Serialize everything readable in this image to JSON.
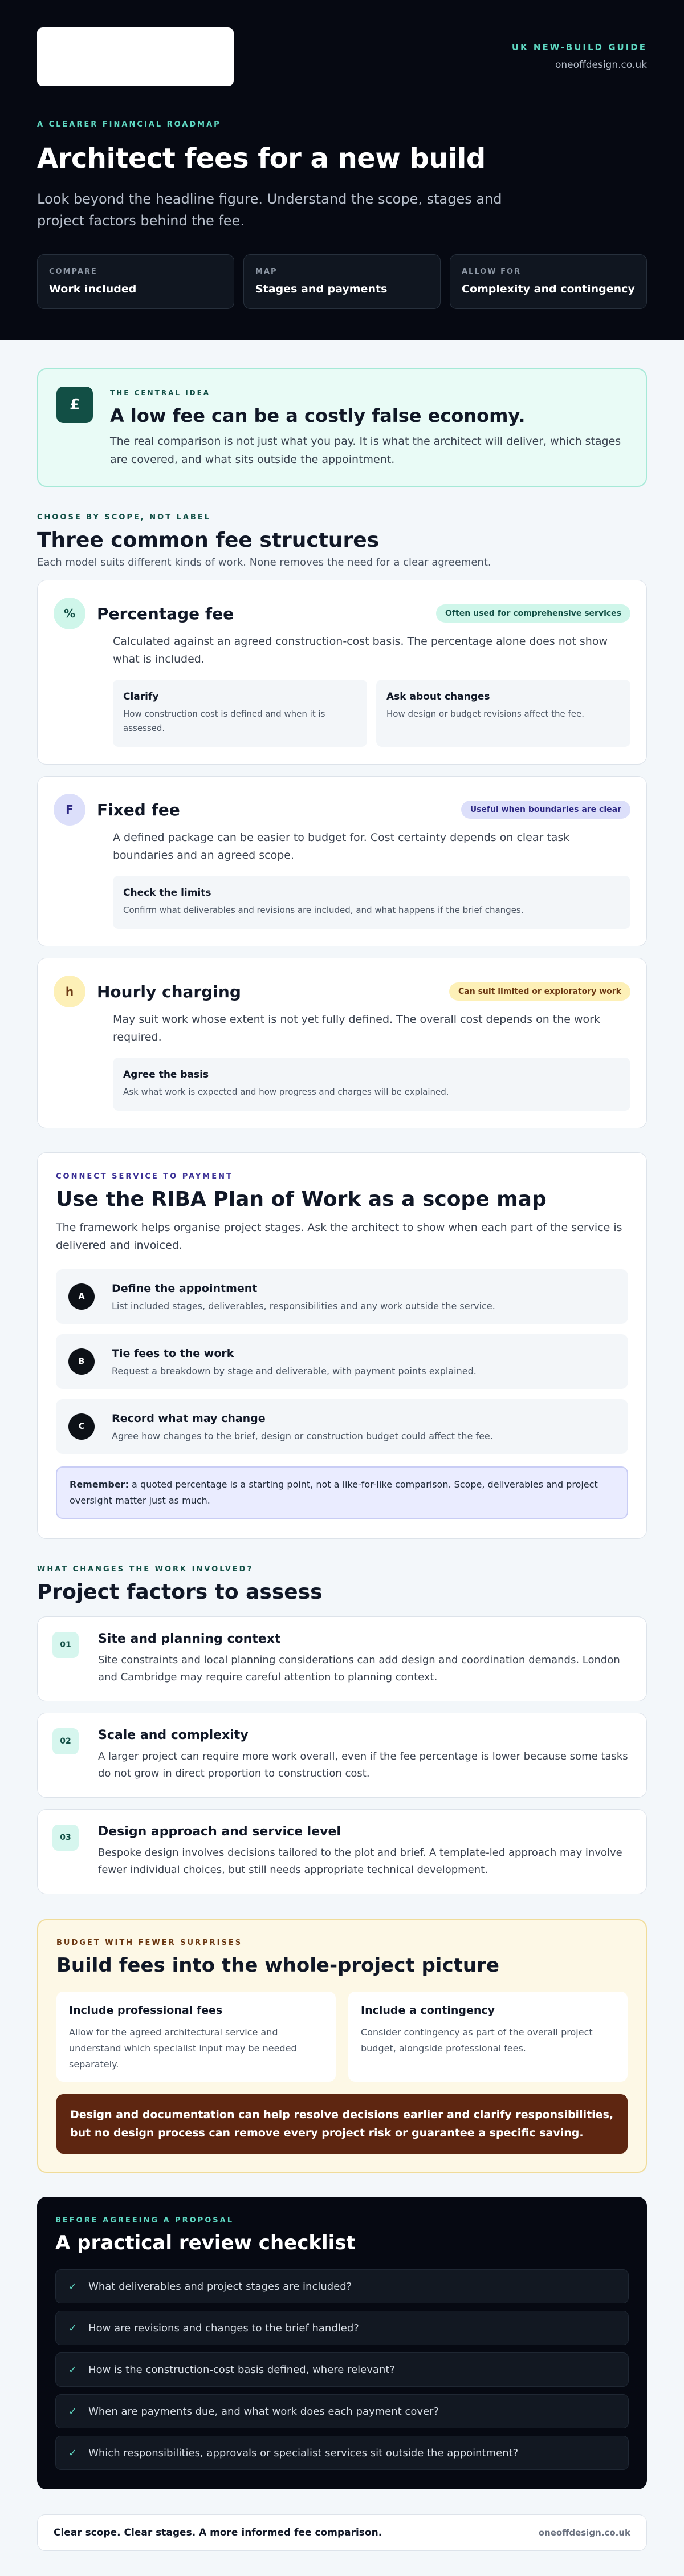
{
  "hero": {
    "guide_label": "UK NEW-BUILD GUIDE",
    "site": "oneoffdesign.co.uk",
    "eyebrow": "A CLEARER FINANCIAL ROADMAP",
    "title": "Architect fees for a new build",
    "lead": "Look beyond the headline figure. Understand the scope, stages and project factors behind the fee.",
    "pills": [
      {
        "small": "COMPARE",
        "big": "Work included"
      },
      {
        "small": "MAP",
        "big": "Stages and payments"
      },
      {
        "small": "ALLOW FOR",
        "big": "Complexity and contingency"
      }
    ]
  },
  "idea": {
    "icon": "£",
    "eyebrow": "THE CENTRAL IDEA",
    "title": "A low fee can be a costly false economy.",
    "text": "The real comparison is not just what you pay. It is what the architect will deliver, which stages are covered, and what sits outside the appointment."
  },
  "structures": {
    "eyebrow": "CHOOSE BY SCOPE, NOT LABEL",
    "title": "Three common fee structures",
    "sub": "Each model suits different kinds of work. None removes the need for a clear agreement.",
    "items": [
      {
        "icon": "%",
        "name": "Percentage fee",
        "tag": "Often used for comprehensive services",
        "tag_bg": "#cff6ea",
        "tag_fg": "#124f45",
        "icon_bg": "#cff6ea",
        "icon_fg": "#124f45",
        "desc": "Calculated against an agreed construction-cost basis. The percentage alone does not show what is included.",
        "boxes": [
          {
            "title": "Clarify",
            "text": "How construction cost is defined and when it is assessed."
          },
          {
            "title": "Ask about changes",
            "text": "How design or budget revisions affect the fee."
          }
        ]
      },
      {
        "icon": "F",
        "name": "Fixed fee",
        "tag": "Useful when boundaries are clear",
        "tag_bg": "#dcdffa",
        "tag_fg": "#2c2782",
        "icon_bg": "#dcdffa",
        "icon_fg": "#2c2782",
        "desc": "A defined package can be easier to budget for. Cost certainty depends on clear task boundaries and an agreed scope.",
        "boxes": [
          {
            "title": "Check the limits",
            "text": "Confirm what deliverables and revisions are included, and what happens if the brief changes."
          }
        ]
      },
      {
        "icon": "h",
        "name": "Hourly charging",
        "tag": "Can suit limited or exploratory work",
        "tag_bg": "#fdf0b7",
        "tag_fg": "#6b3813",
        "icon_bg": "#fdf0b7",
        "icon_fg": "#6b3813",
        "desc": "May suit work whose extent is not yet fully defined. The overall cost depends on the work required.",
        "boxes": [
          {
            "title": "Agree the basis",
            "text": "Ask what work is expected and how progress and charges will be explained."
          }
        ]
      }
    ]
  },
  "riba": {
    "eyebrow": "CONNECT SERVICE TO PAYMENT",
    "title": "Use the RIBA Plan of Work as a scope map",
    "text": "The framework helps organise project stages. Ask the architect to show when each part of the service is delivered and invoiced.",
    "steps": [
      {
        "num": "A",
        "title": "Define the appointment",
        "text": "List included stages, deliverables, responsibilities and any work outside the service."
      },
      {
        "num": "B",
        "title": "Tie fees to the work",
        "text": "Request a breakdown by stage and deliverable, with payment points explained."
      },
      {
        "num": "C",
        "title": "Record what may change",
        "text": "Agree how changes to the brief, design or construction budget could affect the fee."
      }
    ],
    "remember_label": "Remember:",
    "remember_text": " a quoted percentage is a starting point, not a like-for-like comparison. Scope, deliverables and project oversight matter just as much."
  },
  "factors": {
    "eyebrow": "WHAT CHANGES THE WORK INVOLVED?",
    "title": "Project factors to assess",
    "items": [
      {
        "num": "01",
        "title": "Site and planning context",
        "text": "Site constraints and local planning considerations can add design and coordination demands. London and Cambridge may require careful attention to planning context."
      },
      {
        "num": "02",
        "title": "Scale and complexity",
        "text": "A larger project can require more work overall, even if the fee percentage is lower because some tasks do not grow in direct proportion to construction cost."
      },
      {
        "num": "03",
        "title": "Design approach and service level",
        "text": "Bespoke design involves decisions tailored to the plot and brief. A template-led approach may involve fewer individual choices, but still needs appropriate technical development."
      }
    ]
  },
  "budget": {
    "eyebrow": "BUDGET WITH FEWER SURPRISES",
    "title": "Build fees into the whole-project picture",
    "boxes": [
      {
        "title": "Include professional fees",
        "text": "Allow for the agreed architectural service and understand which specialist input may be needed separately."
      },
      {
        "title": "Include a contingency",
        "text": "Consider contingency as part of the overall project budget, alongside professional fees."
      }
    ],
    "callout": "Design and documentation can help resolve decisions earlier and clarify responsibilities, but no design process can remove every project risk or guarantee a specific saving."
  },
  "checklist": {
    "eyebrow": "BEFORE AGREEING A PROPOSAL",
    "title": "A practical review checklist",
    "check_mark": "✓",
    "items": [
      "What deliverables and project stages are included?",
      "How are revisions and changes to the brief handled?",
      "How is the construction-cost basis defined, where relevant?",
      "When are payments due, and what work does each payment cover?",
      "Which responsibilities, approvals or specialist services sit outside the appointment?"
    ]
  },
  "footer": {
    "text": "Clear scope. Clear stages. A more informed fee comparison.",
    "site": "oneoffdesign.co.uk"
  }
}
